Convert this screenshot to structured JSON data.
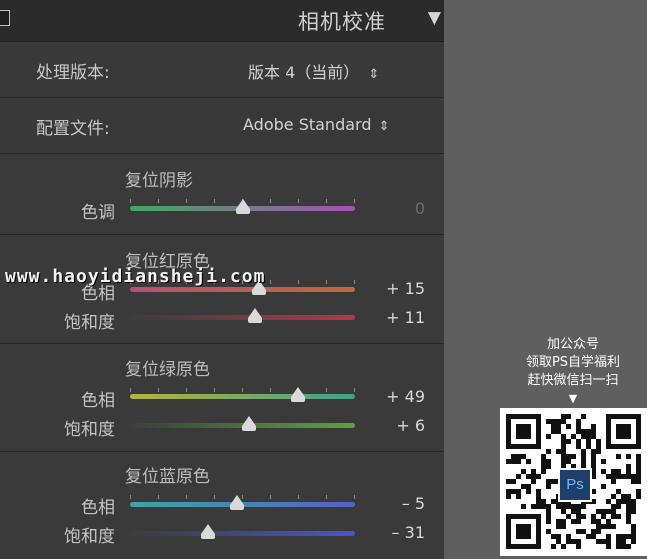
{
  "panel": {
    "title": "相机校准",
    "collapse_icon": "triangle-down-icon"
  },
  "process": {
    "label": "处理版本:",
    "value": "版本 4（当前）",
    "icon": "updown-chevron-icon"
  },
  "profile": {
    "label": "配置文件:",
    "value": "Adobe Standard",
    "icon": "updown-chevron-icon"
  },
  "shadows": {
    "title": "复位阴影",
    "sliders": [
      {
        "label": "色调",
        "value": "0",
        "fraction": 0.5
      }
    ]
  },
  "red_primary": {
    "title": "复位红原色",
    "sliders": [
      {
        "label": "色相",
        "value": "+ 15",
        "fraction": 0.575
      },
      {
        "label": "饱和度",
        "value": "+ 11",
        "fraction": 0.555
      }
    ]
  },
  "green_primary": {
    "title": "复位绿原色",
    "sliders": [
      {
        "label": "色相",
        "value": "+ 49",
        "fraction": 0.745
      },
      {
        "label": "饱和度",
        "value": "+ 6",
        "fraction": 0.53
      }
    ]
  },
  "blue_primary": {
    "title": "复位蓝原色",
    "sliders": [
      {
        "label": "色相",
        "value": "– 5",
        "fraction": 0.475
      },
      {
        "label": "饱和度",
        "value": "– 31",
        "fraction": 0.345
      }
    ]
  },
  "watermark": "www.haoyidiansheji.com",
  "promo": {
    "line1": "加公众号",
    "line2": "领取PS自学福利",
    "line3": "赶快微信扫一扫",
    "arrow": "▼",
    "badge": "Ps"
  },
  "colors": {
    "panel_bg": "#3a3a3a",
    "header_bg": "#2b2b2b",
    "side_bg": "#5f5f5f",
    "tint_gradient": [
      "#3fa85c",
      "#a84fb4"
    ],
    "red_hue_gradient": [
      "#b4506f",
      "#c06a3c"
    ],
    "red_sat_gradient": [
      "#3c3c3c",
      "#b03a4a"
    ],
    "green_hue_gradient": [
      "#b6b33e",
      "#3fa08a"
    ],
    "green_sat_gradient": [
      "#3c3c3c",
      "#5aa53e"
    ],
    "blue_hue_gradient": [
      "#3aa6a3",
      "#5660c8"
    ],
    "blue_sat_gradient": [
      "#3c3c3c",
      "#4b55c8"
    ]
  }
}
